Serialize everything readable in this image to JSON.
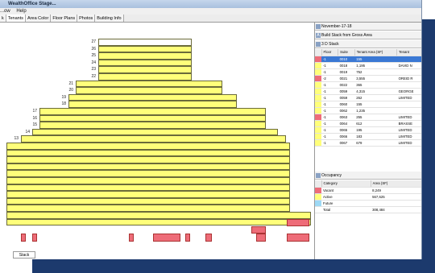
{
  "window": {
    "title": "WealthOffice Stage...",
    "menu": [
      "...ow",
      "Help"
    ]
  },
  "tabs": [
    "k",
    "Tenants",
    "Area Color",
    "Floor Plans",
    "Photos",
    "Building Info"
  ],
  "active_tab": "Tenants",
  "floors": [
    "27",
    "26",
    "25",
    "24",
    "23",
    "22",
    "21",
    "20",
    "19",
    "18",
    "17",
    "16",
    "15",
    "14",
    "13"
  ],
  "stack_tab": "Stack",
  "right": {
    "date": "November-17-18",
    "build_label": "Build Stack from Gross Area",
    "stack_label": "3 D Stack",
    "table": {
      "headers": [
        "",
        "Floor",
        "Suite",
        "Tenant Area (SF)",
        "Tenant"
      ],
      "rows": [
        [
          "-1",
          "0010",
          "155",
          ""
        ],
        [
          "-1",
          "0018",
          "1,195",
          "DAVID N"
        ],
        [
          "-1",
          "0019",
          "752",
          ""
        ],
        [
          "-2",
          "0021",
          "3,555",
          "OREID R"
        ],
        [
          "-1",
          "0022",
          "365",
          ""
        ],
        [
          "-1",
          "0059",
          "4,315",
          "GEORGE"
        ],
        [
          "-1",
          "0059",
          "262",
          "LIMITED"
        ],
        [
          "-1",
          "0060",
          "155",
          ""
        ],
        [
          "-1",
          "0062",
          "1,235",
          ""
        ],
        [
          "-1",
          "0063",
          "255",
          "LIMITED"
        ],
        [
          "-1",
          "0064",
          "612",
          "BRASSE"
        ],
        [
          "-1",
          "0065",
          "195",
          "LIMITED"
        ],
        [
          "-1",
          "0066",
          "183",
          "LIMITED"
        ],
        [
          "-1",
          "0067",
          "679",
          "LIMITED"
        ]
      ]
    },
    "occupancy": {
      "label": "Occupancy",
      "headers": [
        "Category",
        "Area (SF)"
      ],
      "rows": [
        [
          "Vacant",
          "8,249"
        ],
        [
          "Active",
          "567,625"
        ],
        [
          "Future",
          ""
        ],
        [
          "Total",
          "308,484"
        ]
      ]
    }
  },
  "colors": {
    "tenant": "#ffff7a",
    "vacant": "#ee6c78",
    "selection": "#3a78d4",
    "panel_bg": "#1c3a6d"
  }
}
